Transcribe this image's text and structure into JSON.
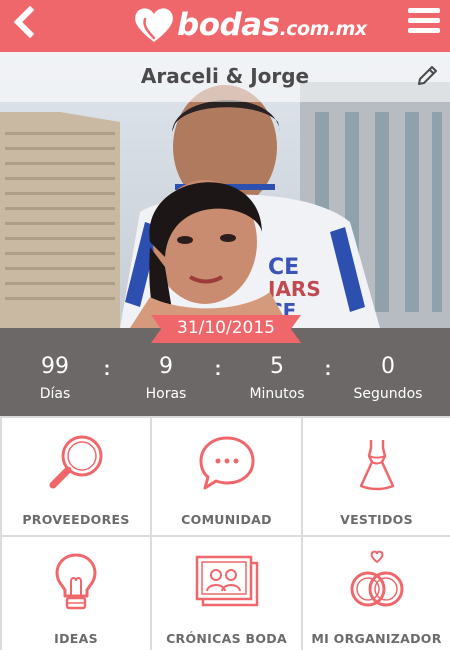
{
  "header": {
    "logo_text": "bodas",
    "logo_domain": ".com.mx",
    "brand_color": "#f0676b"
  },
  "hero": {
    "couple_name": "Araceli & Jorge",
    "date": "31/10/2015"
  },
  "countdown": {
    "units": [
      {
        "value": "99",
        "label": "Días"
      },
      {
        "value": "9",
        "label": "Horas"
      },
      {
        "value": "5",
        "label": "Minutos"
      },
      {
        "value": "0",
        "label": "Segundos"
      }
    ],
    "separator": ":"
  },
  "menu": {
    "tiles": [
      {
        "label": "PROVEEDORES",
        "icon": "magnifier-icon"
      },
      {
        "label": "COMUNIDAD",
        "icon": "chat-bubble-icon"
      },
      {
        "label": "VESTIDOS",
        "icon": "dress-icon"
      },
      {
        "label": "IDEAS",
        "icon": "lightbulb-icon"
      },
      {
        "label": "CRÓNICAS BODA",
        "icon": "photo-album-icon"
      },
      {
        "label": "MI ORGANIZADOR",
        "icon": "rings-icon"
      }
    ],
    "icon_color": "#f0676b"
  }
}
